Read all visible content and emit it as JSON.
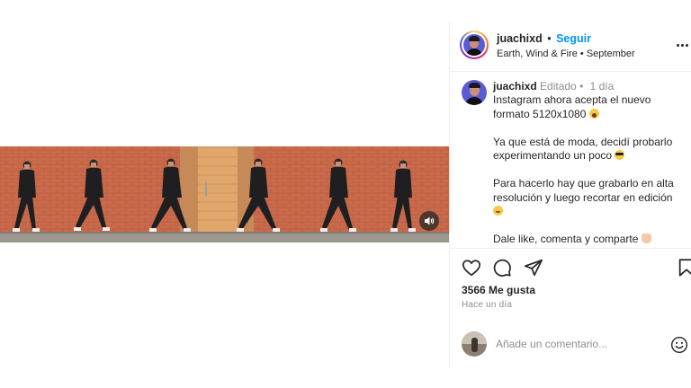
{
  "post": {
    "username": "juachixd",
    "separator": "•",
    "follow_label": "Seguir",
    "audio": "Earth, Wind & Fire",
    "audio_separator": "•",
    "audio_track": "September"
  },
  "caption": {
    "username": "juachixd",
    "edited": "Editado",
    "dot": "•",
    "age": "1 día",
    "paragraphs": [
      "Instagram ahora acepta el nuevo formato 5120x1080",
      "Ya que está de moda, decidí probarlo experimentando un poco",
      "Para hacerlo hay que grabarlo en alta resolución y luego recortar en edición",
      "Dale like, comenta y comparte"
    ]
  },
  "actions": {
    "likes": "3566 Me gusta",
    "posted": "Hace un día"
  },
  "comment_box": {
    "placeholder": "Añade un comentario..."
  },
  "icons": {
    "more": "more-icon",
    "like": "heart-icon",
    "comment": "comment-icon",
    "share": "share-icon",
    "save": "bookmark-icon",
    "audio": "speaker-icon",
    "emoji": "smiley-icon"
  },
  "colors": {
    "follow": "#0095f6",
    "wall": "#c86647",
    "door": "#d9a36a",
    "muted_text": "#8e8e8e"
  }
}
